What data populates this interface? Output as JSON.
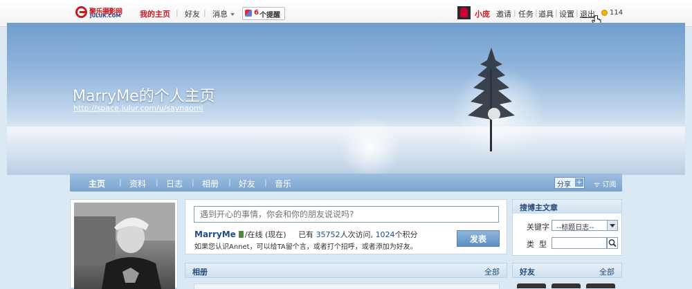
{
  "topbar": {
    "logo": {
      "cn": "聚乐摄影网",
      "en": "JULUR.COM"
    },
    "my_home": "我的主页",
    "friends": "好友",
    "messages": "消息",
    "remind_count": "6",
    "remind_label": "个提醒",
    "username": "小庞",
    "links": {
      "invite": "邀请",
      "task": "任务",
      "props": "道具",
      "settings": "设置",
      "logout": "退出"
    },
    "coins": "114"
  },
  "banner": {
    "title": "MarryMe的个人主页",
    "url": "http://space.julur.com/u/saynaomi"
  },
  "page_nav": {
    "items": [
      "主页",
      "资料",
      "日志",
      "相册",
      "好友",
      "音乐"
    ],
    "share": "分享",
    "subscribe": "订阅"
  },
  "post": {
    "placeholder": "遇到开心的事情，你会和你的朋友说说吗?",
    "owner_name": "MarryMe",
    "status": "/在线 (现在)",
    "visits_prefix": "已有",
    "visits": "35752",
    "visits_suffix": "人次访问,",
    "points": "1024",
    "points_suffix": "个积分",
    "hint": "如果您认识Annet，可以给TA留个言，或者打个招呼，或者添加为好友。",
    "submit": "发表"
  },
  "album": {
    "title": "相册",
    "all": "全部"
  },
  "search": {
    "title": "搜博主文章",
    "keyword_label": "关键字",
    "category_selected": "--标题日志--",
    "type_label": "类  型"
  },
  "friends_box": {
    "title": "好友",
    "all": "全部"
  }
}
